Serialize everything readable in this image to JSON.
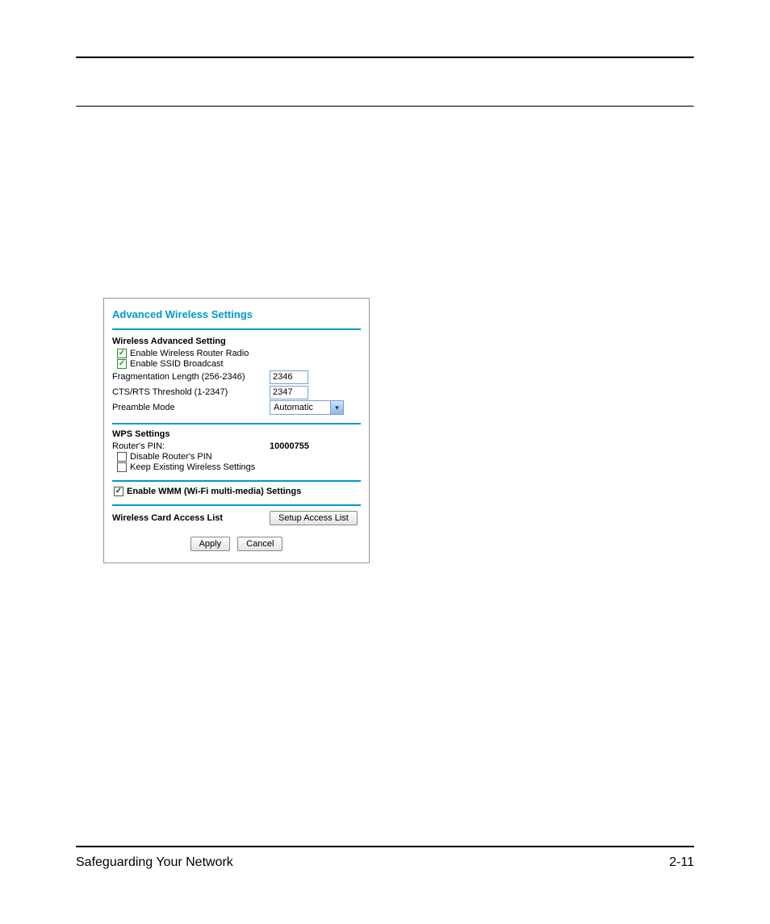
{
  "panel": {
    "title": "Advanced Wireless Settings",
    "wireless_advanced": {
      "heading": "Wireless Advanced Setting",
      "enable_radio_label": "Enable Wireless Router Radio",
      "enable_ssid_label": "Enable SSID Broadcast",
      "frag_label": "Fragmentation Length (256-2346)",
      "frag_value": "2346",
      "cts_label": "CTS/RTS Threshold (1-2347)",
      "cts_value": "2347",
      "preamble_label": "Preamble Mode",
      "preamble_value": "Automatic"
    },
    "wps": {
      "heading": "WPS Settings",
      "pin_label": "Router's PIN:",
      "pin_value": "10000755",
      "disable_pin_label": "Disable Router's PIN",
      "keep_existing_label": "Keep Existing Wireless Settings"
    },
    "wmm": {
      "label": "Enable WMM (Wi-Fi multi-media) Settings"
    },
    "access_list": {
      "label": "Wireless Card Access List",
      "button": "Setup Access List"
    },
    "buttons": {
      "apply": "Apply",
      "cancel": "Cancel"
    }
  },
  "footer": {
    "left": "Safeguarding Your Network",
    "right": "2-11"
  }
}
